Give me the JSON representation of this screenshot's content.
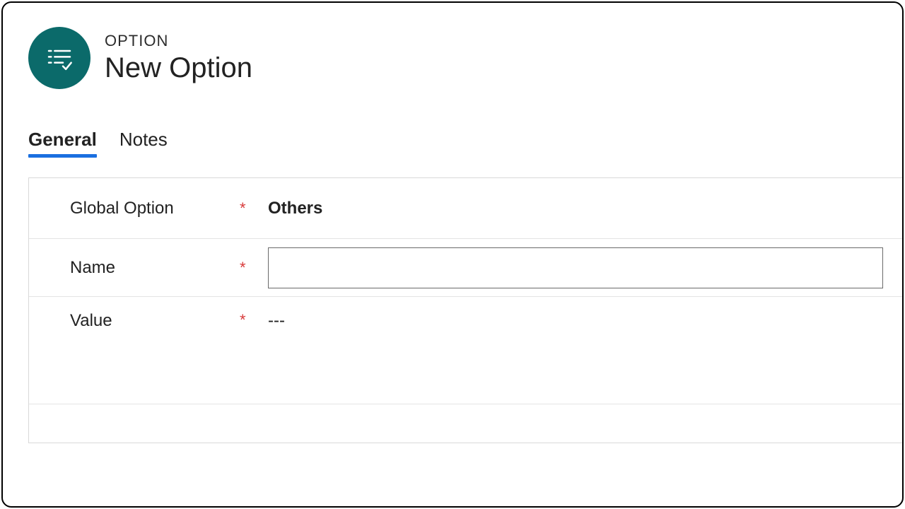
{
  "header": {
    "entity_type": "OPTION",
    "title": "New Option"
  },
  "tabs": {
    "general": "General",
    "notes": "Notes",
    "active": "general"
  },
  "fields": {
    "global_option": {
      "label": "Global Option",
      "required_mark": "*",
      "value": "Others"
    },
    "name": {
      "label": "Name",
      "required_mark": "*",
      "value": ""
    },
    "value": {
      "label": "Value",
      "required_mark": "*",
      "value": "---"
    }
  },
  "icons": {
    "entity": "option-list-icon"
  }
}
